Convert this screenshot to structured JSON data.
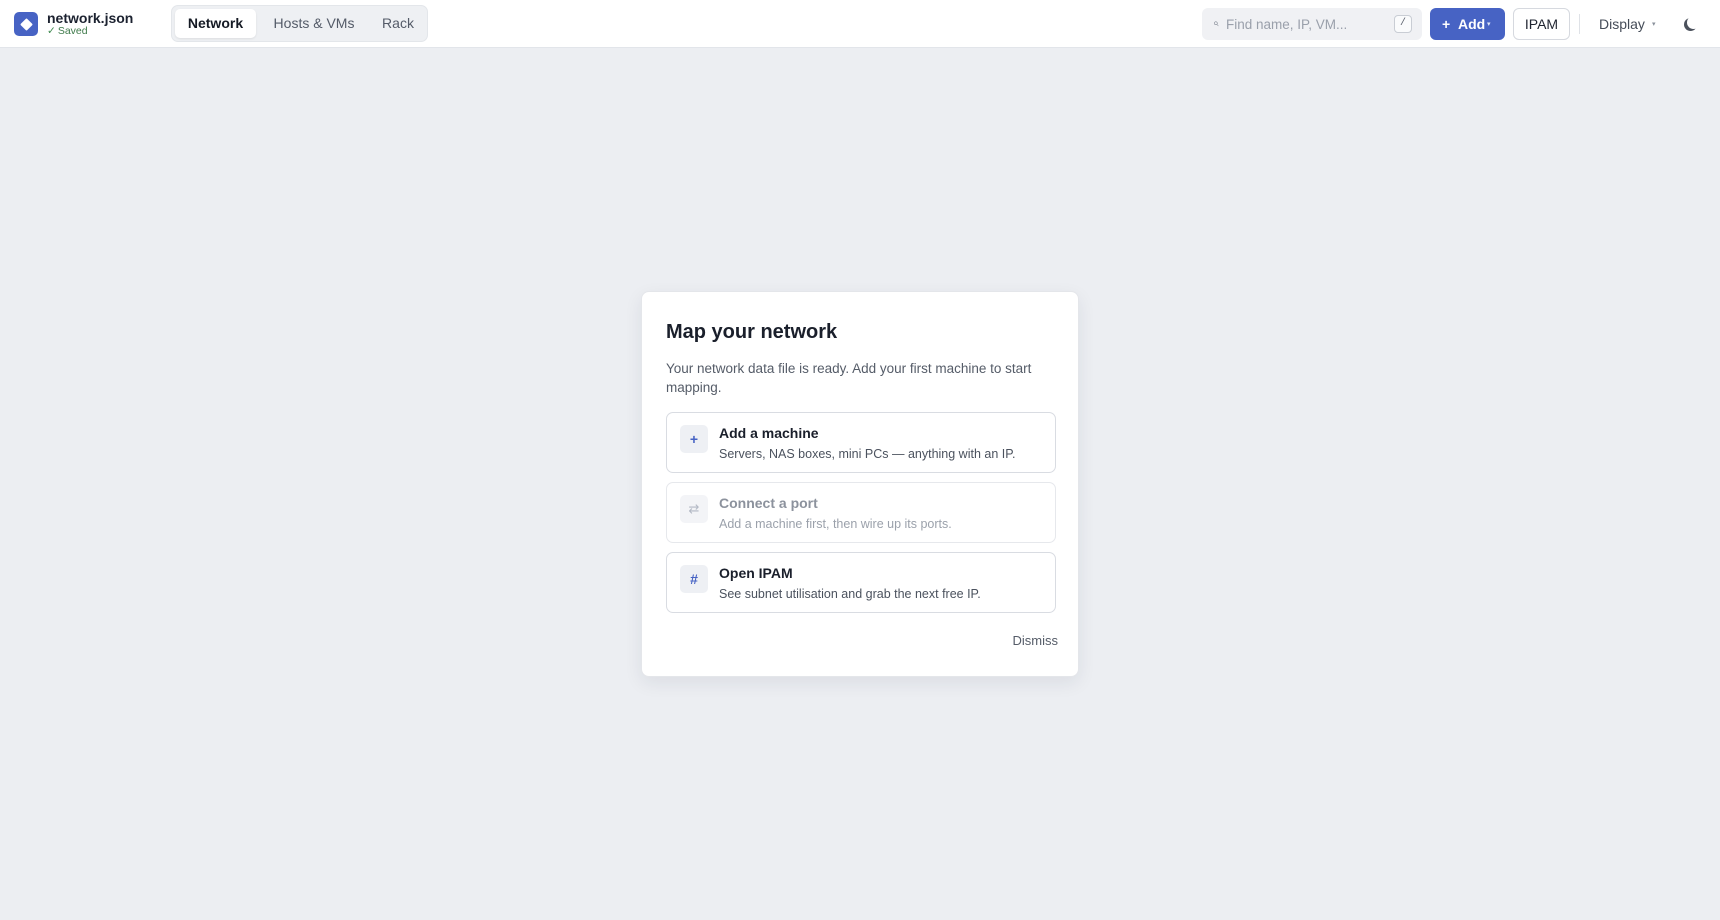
{
  "app": {
    "filename": "network.json",
    "status_check": "✓",
    "status": "Saved"
  },
  "tabs": [
    {
      "label": "Network",
      "active": true
    },
    {
      "label": "Hosts & VMs",
      "active": false
    },
    {
      "label": "Rack",
      "active": false
    }
  ],
  "search": {
    "placeholder": "Find name, IP, VM...",
    "value": "",
    "shortcut": "/"
  },
  "toolbar": {
    "add_plus": "+",
    "add_label": "Add",
    "add_caret": "▾",
    "ipam_label": "IPAM",
    "display_label": "Display",
    "display_caret": "▾",
    "theme_icon": "moon-icon"
  },
  "onboarding": {
    "title": "Map your network",
    "description": "Your network data file is ready. Add your first machine to start mapping.",
    "options": [
      {
        "icon": "+",
        "icon_name": "plus-icon",
        "title": "Add a machine",
        "subtitle": "Servers, NAS boxes, mini PCs — anything with an IP.",
        "enabled": true
      },
      {
        "icon": "⇄",
        "icon_name": "swap-arrows-icon",
        "title": "Connect a port",
        "subtitle": "Add a machine first, then wire up its ports.",
        "enabled": false
      },
      {
        "icon": "#",
        "icon_name": "hash-icon",
        "title": "Open IPAM",
        "subtitle": "See subnet utilisation and grab the next free IP.",
        "enabled": true
      }
    ],
    "dismiss_label": "Dismiss"
  },
  "colors": {
    "accent": "#4763c4",
    "background": "#eceef2",
    "saved_green": "#3e7a4a"
  }
}
